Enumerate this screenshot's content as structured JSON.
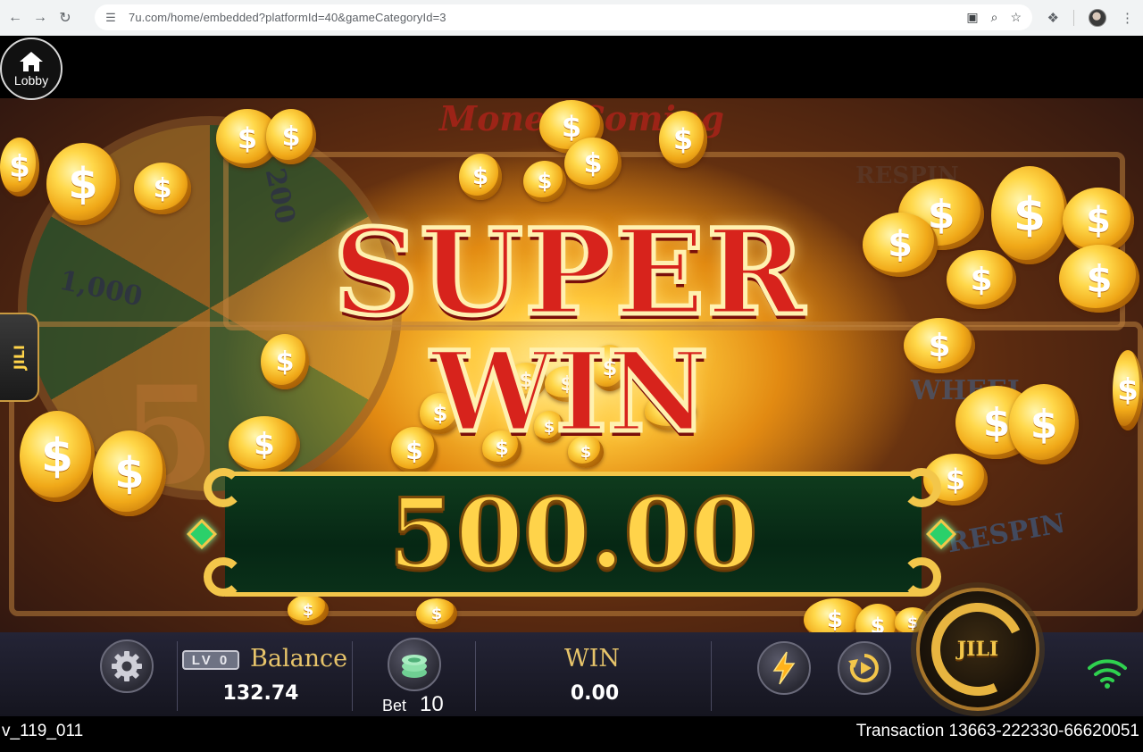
{
  "browser": {
    "url": "7u.com/home/embedded?platformId=40&gameCategoryId=3"
  },
  "game": {
    "lobby_label": "Lobby",
    "side_tab_label": "JILI",
    "banner_title": "Money Coming",
    "respin_label": "RESPIN",
    "wheel_values": [
      "200",
      "1,000",
      "5"
    ],
    "background_labels": [
      "WHEEL",
      "RESPIN"
    ],
    "win_popup": {
      "line1": "SUPER",
      "line2": "WIN",
      "amount": "500.00"
    },
    "controls": {
      "level_badge": "LV 0",
      "balance_label": "Balance",
      "balance_value": "132.74",
      "bet_label": "Bet",
      "bet_value": "10",
      "win_label": "WIN",
      "win_value": "0.00",
      "spin_label": "JILI"
    },
    "icons": [
      "home-icon",
      "gear-icon",
      "chip-stack-icon",
      "lightning-icon",
      "autoplay-icon",
      "wifi-icon"
    ]
  },
  "footer": {
    "version": "v_119_011",
    "transaction": "Transaction 13663-222330-66620051"
  },
  "colors": {
    "accent_gold": "#f3c64a",
    "win_red": "#d7231c",
    "amount_panel": "#0a3019",
    "control_bar": "#1c1c2a"
  }
}
